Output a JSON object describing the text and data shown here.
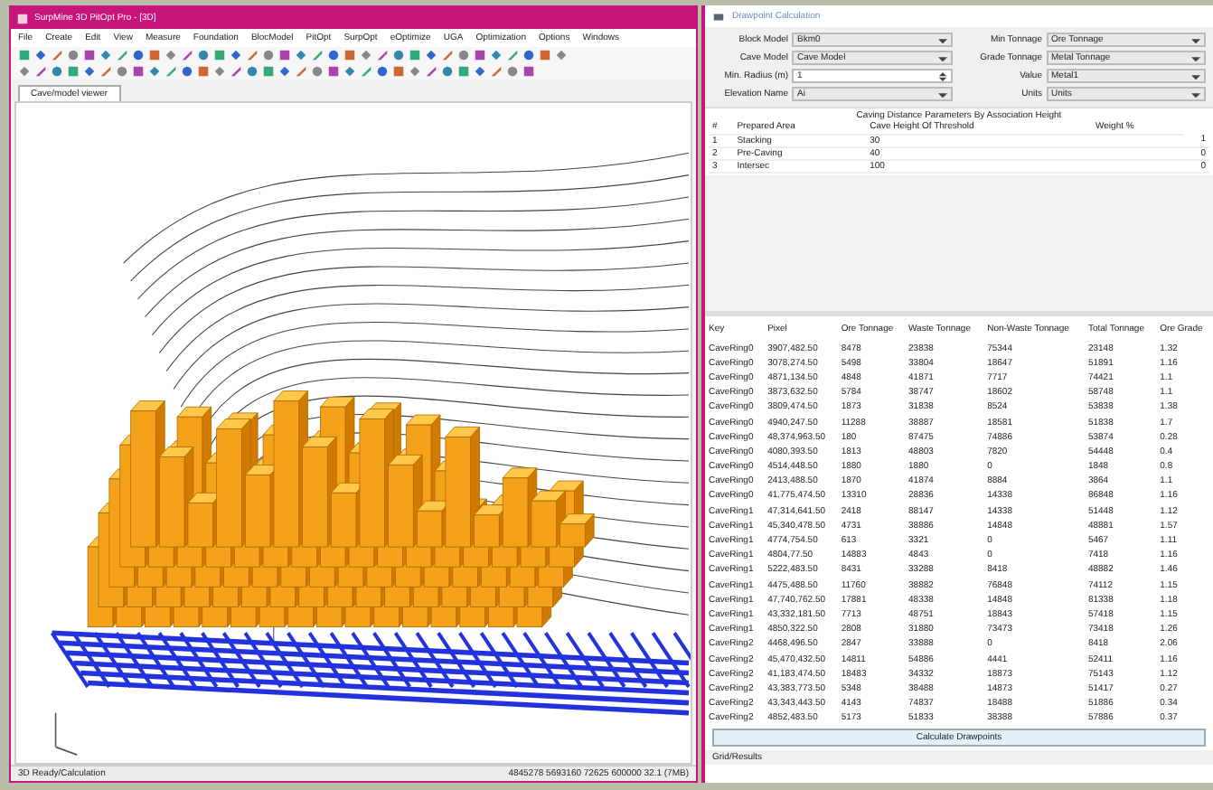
{
  "main_window": {
    "title": "SurpMine 3D PitOpt Pro - [3D]",
    "menu": [
      "File",
      "Create",
      "Edit",
      "View",
      "Measure",
      "Foundation",
      "BlocModel",
      "PitOpt",
      "SurpOpt",
      "eOptimize",
      "UGA",
      "Optimization",
      "Options",
      "Windows"
    ],
    "tab": "Cave/model viewer",
    "status_left": "3D Ready/Calculation",
    "status_right": "4845278 5693160 72625 600000 32.1 (7MB)"
  },
  "calc_window": {
    "title": "Drawpoint Calculation",
    "fields": [
      {
        "label": "Block Model",
        "value": "Bkm0",
        "kind": "dropdown"
      },
      {
        "label": "Min Tonnage",
        "value": "Ore Tonnage",
        "kind": "dropdown"
      },
      {
        "label": "Cave Model",
        "value": "Cave Model",
        "kind": "dropdown"
      },
      {
        "label": "Grade Tonnage",
        "value": "Metal Tonnage",
        "kind": "dropdown"
      },
      {
        "label": "Min. Radius (m)",
        "value": "1",
        "kind": "spinner"
      },
      {
        "label": "Value",
        "value": "Metal1",
        "kind": "dropdown"
      },
      {
        "label": "Elevation Name",
        "value": "Ai",
        "kind": "dropdown"
      },
      {
        "label": "Units",
        "value": "Units",
        "kind": "dropdown"
      }
    ],
    "group_title": "Caving Distance Parameters By Association Height",
    "group_columns": [
      "#",
      "Prepared Area",
      "Cave Height Of Threshold",
      "Weight %"
    ],
    "group_rows": [
      [
        "1",
        "Stacking",
        "30",
        "",
        "1"
      ],
      [
        "2",
        "Pre-Caving",
        "40",
        "",
        "0"
      ],
      [
        "3",
        "Intersec",
        "100",
        "",
        "0"
      ]
    ],
    "table": {
      "columns": [
        "Key",
        "Pixel",
        "Ore Tonnage",
        "Waste Tonnage",
        "Non-Waste Tonnage",
        "Total Tonnage",
        "Ore Grade"
      ],
      "rows": [
        [
          "CaveRing0",
          "3907,482.50",
          "8478",
          "23838",
          "75344",
          "23148",
          "1.32"
        ],
        [
          "CaveRing0",
          "3078,274.50",
          "5498",
          "33804",
          "18647",
          "51891",
          "1.16"
        ],
        [
          "CaveRing0",
          "4871,134.50",
          "4848",
          "41871",
          "7717",
          "74421",
          "1.1"
        ],
        [
          "CaveRing0",
          "3873,632.50",
          "5784",
          "38747",
          "18602",
          "58748",
          "1.1"
        ],
        [
          "CaveRing0",
          "3809,474.50",
          "1873",
          "31838",
          "8524",
          "53838",
          "1.38"
        ],
        [
          "CaveRing0",
          "4940,247.50",
          "11288",
          "38887",
          "18581",
          "51838",
          "1.7"
        ],
        [
          "CaveRing0",
          "48,374,963.50",
          "180",
          "87475",
          "74886",
          "53874",
          "0.28"
        ],
        [
          "CaveRing0",
          "4080,393.50",
          "1813",
          "48803",
          "7820",
          "54448",
          "0.4"
        ],
        [
          "CaveRing0",
          "4514,448.50",
          "1880",
          "1880",
          "0",
          "1848",
          "0.8"
        ],
        [
          "CaveRing0",
          "2413,488.50",
          "1870",
          "41874",
          "8884",
          "3864",
          "1.1"
        ],
        [
          "CaveRing0",
          "41,775,474.50",
          "13310",
          "28836",
          "14338",
          "86848",
          "1.16"
        ],
        [
          "CaveRing1",
          "47,314,641.50",
          "2418",
          "88147",
          "14338",
          "51448",
          "1.12"
        ],
        [
          "CaveRing1",
          "45,340,478.50",
          "4731",
          "38886",
          "14848",
          "48881",
          "1.57"
        ],
        [
          "CaveRing1",
          "4774,754.50",
          "613",
          "3321",
          "0",
          "5467",
          "1.11"
        ],
        [
          "CaveRing1",
          "4804,77.50",
          "14883",
          "4843",
          "0",
          "7418",
          "1.16"
        ],
        [
          "CaveRing1",
          "5222,483.50",
          "8431",
          "33288",
          "8418",
          "48882",
          "1.46"
        ],
        [
          "CaveRing1",
          "4475,488.50",
          "11760",
          "38882",
          "76848",
          "74112",
          "1.15"
        ],
        [
          "CaveRing1",
          "47,740,762.50",
          "17881",
          "48338",
          "14848",
          "81338",
          "1.18"
        ],
        [
          "CaveRing1",
          "43,332,181.50",
          "7713",
          "48751",
          "18843",
          "57418",
          "1.15"
        ],
        [
          "CaveRing1",
          "4850,322.50",
          "2808",
          "31880",
          "73473",
          "73418",
          "1.26"
        ],
        [
          "CaveRing2",
          "4468,496.50",
          "2847",
          "33888",
          "0",
          "8418",
          "2.06"
        ],
        [
          "CaveRing2",
          "45,470,432.50",
          "14811",
          "54886",
          "4441",
          "52411",
          "1.16"
        ],
        [
          "CaveRing2",
          "41,183,474.50",
          "18483",
          "34332",
          "18873",
          "75143",
          "1.12"
        ],
        [
          "CaveRing2",
          "43,383,773.50",
          "5348",
          "38488",
          "14873",
          "51417",
          "0.27"
        ],
        [
          "CaveRing2",
          "43,343,443.50",
          "4143",
          "74837",
          "18488",
          "51886",
          "0.34"
        ],
        [
          "CaveRing2",
          "4852,483.50",
          "5173",
          "51833",
          "38388",
          "57886",
          "0.37"
        ]
      ]
    },
    "button": "Calculate Drawpoints",
    "bottom_tab": "Grid/Results"
  }
}
